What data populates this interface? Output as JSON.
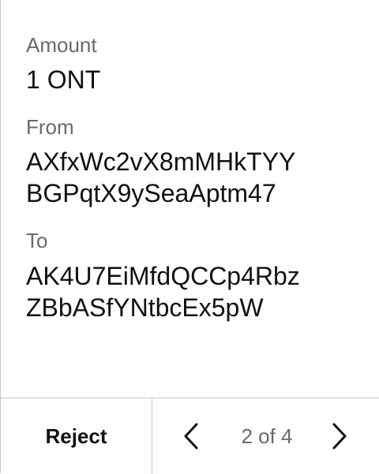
{
  "transaction": {
    "amount_label": "Amount",
    "amount_value": "1 ONT",
    "from_label": "From",
    "from_address_line1": "AXfxWc2vX8mMHkTYY",
    "from_address_line2": "BGPqtX9ySeaAptm47",
    "to_label": "To",
    "to_address_line1": "AK4U7EiMfdQCCp4Rbz",
    "to_address_line2": "ZBbASfYNtbcEx5pW"
  },
  "footer": {
    "reject_label": "Reject",
    "pager_text": "2 of 4",
    "prev_icon": "chevron-left-icon",
    "next_icon": "chevron-right-icon"
  }
}
